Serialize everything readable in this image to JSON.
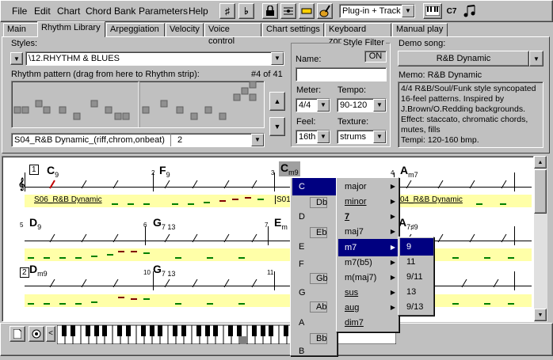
{
  "menu": [
    "File",
    "Edit",
    "Chart",
    "Chord Bank",
    "Parameters",
    "Help"
  ],
  "toolbar": {
    "sharp": "♯",
    "flat": "♭",
    "mode_select": "Plug-in + Track",
    "chord_sym": "C7"
  },
  "tabs": [
    "Main",
    "Rhythm Library",
    "Arpeggiation",
    "Velocity",
    "Voice control",
    "Chart settings",
    "Keyboard zones",
    "Manual play"
  ],
  "library": {
    "styles_label": "Styles:",
    "style_value": "\\12.RHYTHM & BLUES",
    "pattern_label": "Rhythm pattern (drag from here to Rhythm strip):",
    "pattern_count": "#4 of 41",
    "pattern_value": "S04_R&B Dynamic_(riff,chrom,onbeat)",
    "pattern_num": "2"
  },
  "filter": {
    "title": "Style Filter",
    "name_label": "Name:",
    "on": "ON",
    "meter_label": "Meter:",
    "meter": "4/4",
    "tempo_label": "Tempo:",
    "tempo": "90-120",
    "feel_label": "Feel:",
    "feel": "16th",
    "texture_label": "Texture:",
    "texture": "strums"
  },
  "demo": {
    "label": "Demo song:",
    "value": "R&B Dynamic",
    "memo_label": "Memo: R&B Dynamic",
    "memo": [
      "4/4 R&B/Soul/Funk style syncopated",
      "16-feel patterns. Inspired by",
      "J.Brown/O.Redding backgrounds.",
      "Effect: staccato, chromatic chords,",
      "mutes, fills",
      "Tempi: 120-160 bmp."
    ]
  },
  "sheet": {
    "rows": [
      {
        "num": "1",
        "measures": [
          "",
          "2",
          "3",
          "4"
        ],
        "chords": [
          {
            "root": "C",
            "q": "9"
          },
          {
            "root": "F",
            "q": "9"
          },
          {
            "root": "C",
            "q": "m9"
          },
          {
            "root": "A",
            "q": "m7"
          }
        ],
        "lane_labels": [
          "S06_R&B Dynamic",
          "S01",
          "04_R&B Dynamic"
        ]
      },
      {
        "num": "5",
        "measures": [
          "5",
          "6",
          "7",
          "8"
        ],
        "chords": [
          {
            "root": "D",
            "q": "9"
          },
          {
            "root": "G",
            "q": "7 13"
          },
          {
            "root": "E",
            "q": "m"
          },
          {
            "root": "A",
            "q": "7♯9"
          }
        ]
      },
      {
        "num": "2",
        "measures": [
          "",
          "10",
          "11",
          ""
        ],
        "chords": [
          {
            "root": "D",
            "q": "m9"
          },
          {
            "root": "G",
            "q": "7 13"
          }
        ]
      }
    ]
  },
  "root_menu": [
    "C",
    "Db",
    "D",
    "Eb",
    "E",
    "F",
    "Gb",
    "G",
    "Ab",
    "A",
    "Bb",
    "B"
  ],
  "quality_menu": [
    "major",
    "minor",
    "7",
    "maj7",
    "m7",
    "m7(b5)",
    "m(maj7)",
    "sus",
    "aug",
    "dim7"
  ],
  "ext_menu": [
    "9",
    "11",
    "9/11",
    "13",
    "9/13"
  ],
  "colors": {
    "accent": "#000080",
    "lane": "#ffffa8",
    "note_green": "#008000",
    "note_red": "#800000"
  }
}
